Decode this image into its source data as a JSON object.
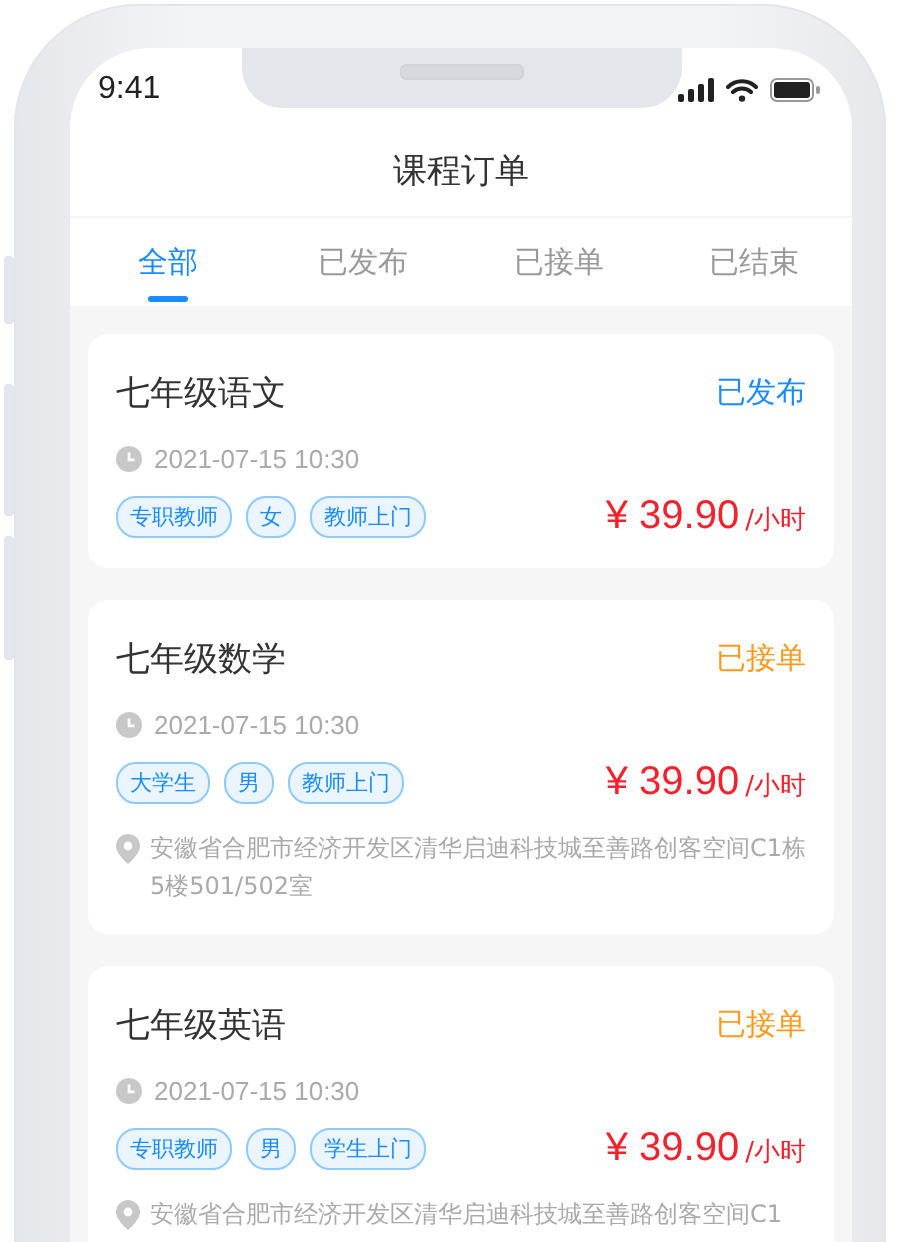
{
  "status_bar": {
    "time": "9:41"
  },
  "title": "课程订单",
  "tabs": [
    {
      "label": "全部",
      "selected": true
    },
    {
      "label": "已发布",
      "selected": false
    },
    {
      "label": "已接单",
      "selected": false
    },
    {
      "label": "已结束",
      "selected": false
    }
  ],
  "orders": [
    {
      "title": "七年级语文",
      "status": {
        "text": "已发布",
        "kind": "published"
      },
      "time": "2021-07-15 10:30",
      "tags": [
        "专职教师",
        "女",
        "教师上门"
      ],
      "price": "¥ 39.90",
      "unit": "/小时"
    },
    {
      "title": "七年级数学",
      "status": {
        "text": "已接单",
        "kind": "accepted"
      },
      "time": "2021-07-15 10:30",
      "tags": [
        "大学生",
        "男",
        "教师上门"
      ],
      "price": "¥ 39.90",
      "unit": "/小时",
      "address": "安徽省合肥市经济开发区清华启迪科技城至善路创客空间C1栋5楼501/502室"
    },
    {
      "title": "七年级英语",
      "status": {
        "text": "已接单",
        "kind": "accepted"
      },
      "time": "2021-07-15 10:30",
      "tags": [
        "专职教师",
        "男",
        "学生上门"
      ],
      "price": "¥ 39.90",
      "unit": "/小时",
      "address": "安徽省合肥市经济开发区清华启迪科技城至善路创客空间C1"
    }
  ]
}
